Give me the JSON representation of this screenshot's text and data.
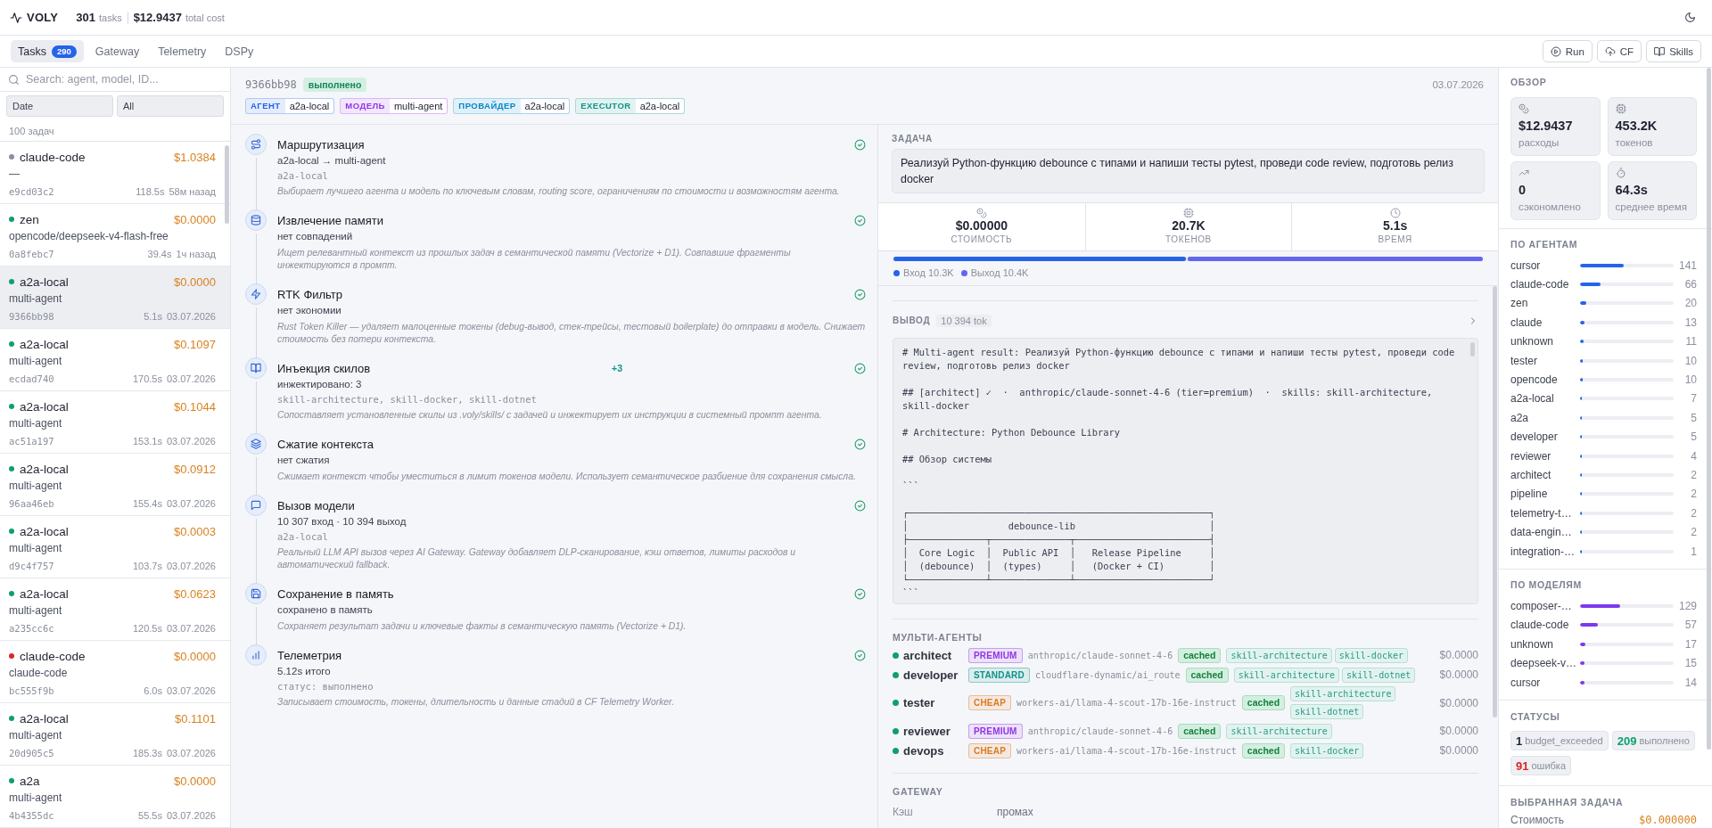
{
  "header": {
    "logo": "VOLY",
    "tasks_count": "301",
    "tasks_label": "tasks",
    "total_cost": "$12.9437",
    "total_cost_label": "total cost"
  },
  "tabs": [
    {
      "label": "Tasks",
      "count": "290",
      "selected": true
    },
    {
      "label": "Gateway",
      "selected": false
    },
    {
      "label": "Telemetry",
      "selected": false
    },
    {
      "label": "DSPy",
      "selected": false
    }
  ],
  "actions": [
    {
      "label": "Run"
    },
    {
      "label": "CF"
    },
    {
      "label": "Skills"
    }
  ],
  "sidebar": {
    "search": {
      "placeholder": "Search: agent, model, ID..."
    },
    "filters": [
      {
        "value": "Date"
      },
      {
        "value": "All"
      }
    ],
    "count": "100 задач",
    "tasks": [
      {
        "agent": "claude-code",
        "cost": "$1.0384",
        "model": "—",
        "id": "e9cd03c2",
        "duration": "118.5s",
        "time": "58м назад",
        "color": "#8b90a0",
        "selected": false
      },
      {
        "agent": "zen",
        "cost": "$0.0000",
        "model": "opencode/deepseek-v4-flash-free",
        "id": "0a8febc7",
        "duration": "39.4s",
        "time": "1ч назад",
        "color": "#0f9f6e",
        "selected": false
      },
      {
        "agent": "a2a-local",
        "cost": "$0.0000",
        "model": "multi-agent",
        "id": "9366bb98",
        "duration": "5.1s",
        "time": "03.07.2026",
        "color": "#0f9f6e",
        "selected": true
      },
      {
        "agent": "a2a-local",
        "cost": "$0.1097",
        "model": "multi-agent",
        "id": "ecdad740",
        "duration": "170.5s",
        "time": "03.07.2026",
        "color": "#0f9f6e",
        "selected": false
      },
      {
        "agent": "a2a-local",
        "cost": "$0.1044",
        "model": "multi-agent",
        "id": "ac51a197",
        "duration": "153.1s",
        "time": "03.07.2026",
        "color": "#0f9f6e",
        "selected": false
      },
      {
        "agent": "a2a-local",
        "cost": "$0.0912",
        "model": "multi-agent",
        "id": "96aa46eb",
        "duration": "155.4s",
        "time": "03.07.2026",
        "color": "#0f9f6e",
        "selected": false
      },
      {
        "agent": "a2a-local",
        "cost": "$0.0003",
        "model": "multi-agent",
        "id": "d9c4f757",
        "duration": "103.7s",
        "time": "03.07.2026",
        "color": "#0f9f6e",
        "selected": false
      },
      {
        "agent": "a2a-local",
        "cost": "$0.0623",
        "model": "multi-agent",
        "id": "a235cc6c",
        "duration": "120.5s",
        "time": "03.07.2026",
        "color": "#0f9f6e",
        "selected": false
      },
      {
        "agent": "claude-code",
        "cost": "$0.0000",
        "model": "claude-code",
        "id": "bc555f9b",
        "duration": "6.0s",
        "time": "03.07.2026",
        "color": "#dc2626",
        "selected": false
      },
      {
        "agent": "a2a-local",
        "cost": "$0.1101",
        "model": "multi-agent",
        "id": "20d905c5",
        "duration": "185.3s",
        "time": "03.07.2026",
        "color": "#0f9f6e",
        "selected": false
      },
      {
        "agent": "a2a",
        "cost": "$0.0000",
        "model": "multi-agent",
        "id": "4b4355dc",
        "duration": "55.5s",
        "time": "03.07.2026",
        "color": "#0f9f6e",
        "selected": false
      }
    ]
  },
  "task": {
    "id": "9366bb98",
    "status": "выполнено",
    "date": "03.07.2026",
    "tags": [
      {
        "key": "АГЕНТ",
        "value": "a2a-local",
        "color": "#2563eb"
      },
      {
        "key": "МОДЕЛЬ",
        "value": "multi-agent",
        "color": "#9333ea"
      },
      {
        "key": "ПРОВАЙДЕР",
        "value": "a2a-local",
        "color": "#0284c7"
      },
      {
        "key": "EXECUTOR",
        "value": "a2a-local",
        "color": "#0d9488"
      }
    ],
    "pipeline": [
      {
        "title": "Маршрутизация",
        "summary": "a2a-local → multi-agent",
        "detail": "a2a-local",
        "description": "Выбирает лучшего агента и модель по ключевым словам, routing score, ограничениям по стоимости и возможностям агента.",
        "done": true
      },
      {
        "title": "Извлечение памяти",
        "summary": "нет совпадений",
        "description": "Ищет релевантный контекст из прошлых задач в семантической памяти (Vectorize + D1). Совпавшие фрагменты инжектируются в промпт.",
        "done": true
      },
      {
        "title": "RTK Фильтр",
        "summary": "нет экономии",
        "description": "Rust Token Killer — удаляет малоценные токены (debug-вывод, стек-трейсы, тестовый boilerplate) до отправки в модель. Снижает стоимость без потери контекста.",
        "done": true
      },
      {
        "title": "Инъекция скилов",
        "badge": "+3",
        "summary": "инжектировано: 3",
        "detail": "skill-architecture, skill-docker, skill-dotnet",
        "description": "Сопоставляет установленные скилы из .voly/skills/ с задачей и инжектирует их инструкции в системный промпт агента.",
        "done": true
      },
      {
        "title": "Сжатие контекста",
        "summary": "нет сжатия",
        "description": "Сжимает контекст чтобы уместиться в лимит токенов модели. Использует семантическое разбиение для сохранения смысла.",
        "done": true
      },
      {
        "title": "Вызов модели",
        "summary": "10 307 вход · 10 394 выход",
        "detail": "a2a-local",
        "description": "Реальный LLM API вызов через AI Gateway. Gateway добавляет DLP-сканирование, кэш ответов, лимиты расходов и автоматический fallback.",
        "done": true
      },
      {
        "title": "Сохранение в память",
        "summary": "сохранено в память",
        "description": "Сохраняет результат задачи и ключевые факты в семантическую память (Vectorize + D1).",
        "done": true
      },
      {
        "title": "Телеметрия",
        "summary": "5.12s итого",
        "detail": "статус: выполнено",
        "description": "Записывает стоимость, токены, длительность и данные стадий в CF Telemetry Worker.",
        "done": true
      }
    ],
    "prompt": {
      "label": "ЗАДАЧА",
      "text": "Реализуй Python-функцию debounce с типами и напиши тесты pytest, проведи code review, подготовь релиз docker"
    },
    "stats": [
      {
        "value": "$0.00000",
        "label": "СТОИМОСТЬ"
      },
      {
        "value": "20.7K",
        "label": "ТОКЕНОВ"
      },
      {
        "value": "5.1s",
        "label": "ВРЕМЯ"
      }
    ],
    "token_bar": [
      {
        "label": "Вход 10.3K",
        "level": 0.498,
        "color": "#2563eb"
      },
      {
        "label": "Выход 10.4K",
        "level": 0.502,
        "color": "#6366f1"
      }
    ],
    "output": {
      "label": "ВЫВОД",
      "tokens": "10 394 tok",
      "text": "# Multi-agent result: Реализуй Python-функцию debounce с типами и напиши тесты pytest, проведи code review, подготовь релиз docker\n\n## [architect] ✓  ·  anthropic/claude-sonnet-4-6 (tier=premium)  ·  skills: skill-architecture, skill-docker\n\n# Architecture: Python Debounce Library\n\n## Обзор системы\n\n```\n\n┌──────────────────────────────────────────────────────┐\n│                  debounce-lib                        │\n├──────────────┬──────────────┬────────────────────────┤\n│  Core Logic  │  Public API  │   Release Pipeline     │\n│  (debounce)  │  (types)     │   (Docker + CI)        │\n└──────────────┴──────────────┴────────────────────────┘\n```"
    },
    "agents": {
      "title": "МУЛЬТИ-АГЕНТЫ",
      "rows": [
        {
          "name": "architect",
          "color": "#0f9f6e",
          "tier": {
            "label": "PREMIUM",
            "color": "#9333ea"
          },
          "model": "anthropic/claude-sonnet-4-6",
          "cache": "cached",
          "skills": [
            "skill-architecture",
            "skill-docker"
          ],
          "cost": "$0.0000"
        },
        {
          "name": "developer",
          "color": "#0f9f6e",
          "tier": {
            "label": "STANDARD",
            "color": "#0d9488"
          },
          "model": "cloudflare-dynamic/ai_route",
          "cache": "cached",
          "skills": [
            "skill-architecture",
            "skill-dotnet"
          ],
          "cost": "$0.0000"
        },
        {
          "name": "tester",
          "color": "#0f9f6e",
          "tier": {
            "label": "CHEAP",
            "color": "#dd7a1e"
          },
          "model": "workers-ai/llama-4-scout-17b-16e-instruct",
          "cache": "cached",
          "skills": [
            "skill-architecture",
            "skill-dotnet"
          ],
          "cost": "$0.0000"
        },
        {
          "name": "reviewer",
          "color": "#0f9f6e",
          "tier": {
            "label": "PREMIUM",
            "color": "#9333ea"
          },
          "model": "anthropic/claude-sonnet-4-6",
          "cache": "cached",
          "skills": [
            "skill-architecture"
          ],
          "cost": "$0.0000"
        },
        {
          "name": "devops",
          "color": "#0f9f6e",
          "tier": {
            "label": "CHEAP",
            "color": "#dd7a1e"
          },
          "model": "workers-ai/llama-4-scout-17b-16e-instruct",
          "cache": "cached",
          "skills": [
            "skill-docker"
          ],
          "cost": "$0.0000"
        }
      ]
    },
    "gateway": {
      "title": "GATEWAY",
      "rows": [
        {
          "label": "Кэш",
          "value": "промах"
        }
      ]
    }
  },
  "overview": {
    "title": "ОБЗОР",
    "cards": [
      {
        "value": "$12.9437",
        "label": "расходы"
      },
      {
        "value": "453.2K",
        "label": "токенов"
      },
      {
        "value": "0",
        "label": "сэкономлено"
      },
      {
        "value": "64.3s",
        "label": "среднее время"
      }
    ]
  },
  "by_agent": {
    "title": "ПО АГЕНТАМ",
    "rows": [
      {
        "name": "cursor",
        "count": "141",
        "level": 0.47
      },
      {
        "name": "claude-code",
        "count": "66",
        "level": 0.22
      },
      {
        "name": "zen",
        "count": "20",
        "level": 0.067
      },
      {
        "name": "claude",
        "count": "13",
        "level": 0.043
      },
      {
        "name": "unknown",
        "count": "11",
        "level": 0.037
      },
      {
        "name": "tester",
        "count": "10",
        "level": 0.033
      },
      {
        "name": "opencode",
        "count": "10",
        "level": 0.033
      },
      {
        "name": "a2a-local",
        "count": "7",
        "level": 0.023
      },
      {
        "name": "a2a",
        "count": "5",
        "level": 0.017
      },
      {
        "name": "developer",
        "count": "5",
        "level": 0.017
      },
      {
        "name": "reviewer",
        "count": "4",
        "level": 0.013
      },
      {
        "name": "architect",
        "count": "2",
        "level": 0.007
      },
      {
        "name": "pipeline",
        "count": "2",
        "level": 0.007
      },
      {
        "name": "telemetry-t…",
        "count": "2",
        "level": 0.007
      },
      {
        "name": "data-engin…",
        "count": "2",
        "level": 0.007
      },
      {
        "name": "integration-…",
        "count": "1",
        "level": 0.003
      }
    ]
  },
  "by_model": {
    "title": "ПО МОДЕЛЯМ",
    "rows": [
      {
        "name": "composer-…",
        "count": "129",
        "level": 0.43
      },
      {
        "name": "claude-code",
        "count": "57",
        "level": 0.19
      },
      {
        "name": "unknown",
        "count": "17",
        "level": 0.057
      },
      {
        "name": "deepseek-v…",
        "count": "15",
        "level": 0.05
      },
      {
        "name": "cursor",
        "count": "14",
        "level": 0.047
      }
    ]
  },
  "statuses": {
    "title": "СТАТУСЫ",
    "items": [
      {
        "count": "1",
        "label": "budget_exceeded",
        "color": "#1f2330"
      },
      {
        "count": "209",
        "label": "выполнено",
        "color": "#0f9f6e"
      },
      {
        "count": "91",
        "label": "ошибка",
        "color": "#dc2626"
      }
    ]
  },
  "selected_task": {
    "title": "ВЫБРАННАЯ ЗАДАЧА",
    "rows": [
      {
        "label": "Стоимость",
        "value": "$0.000000"
      }
    ]
  }
}
